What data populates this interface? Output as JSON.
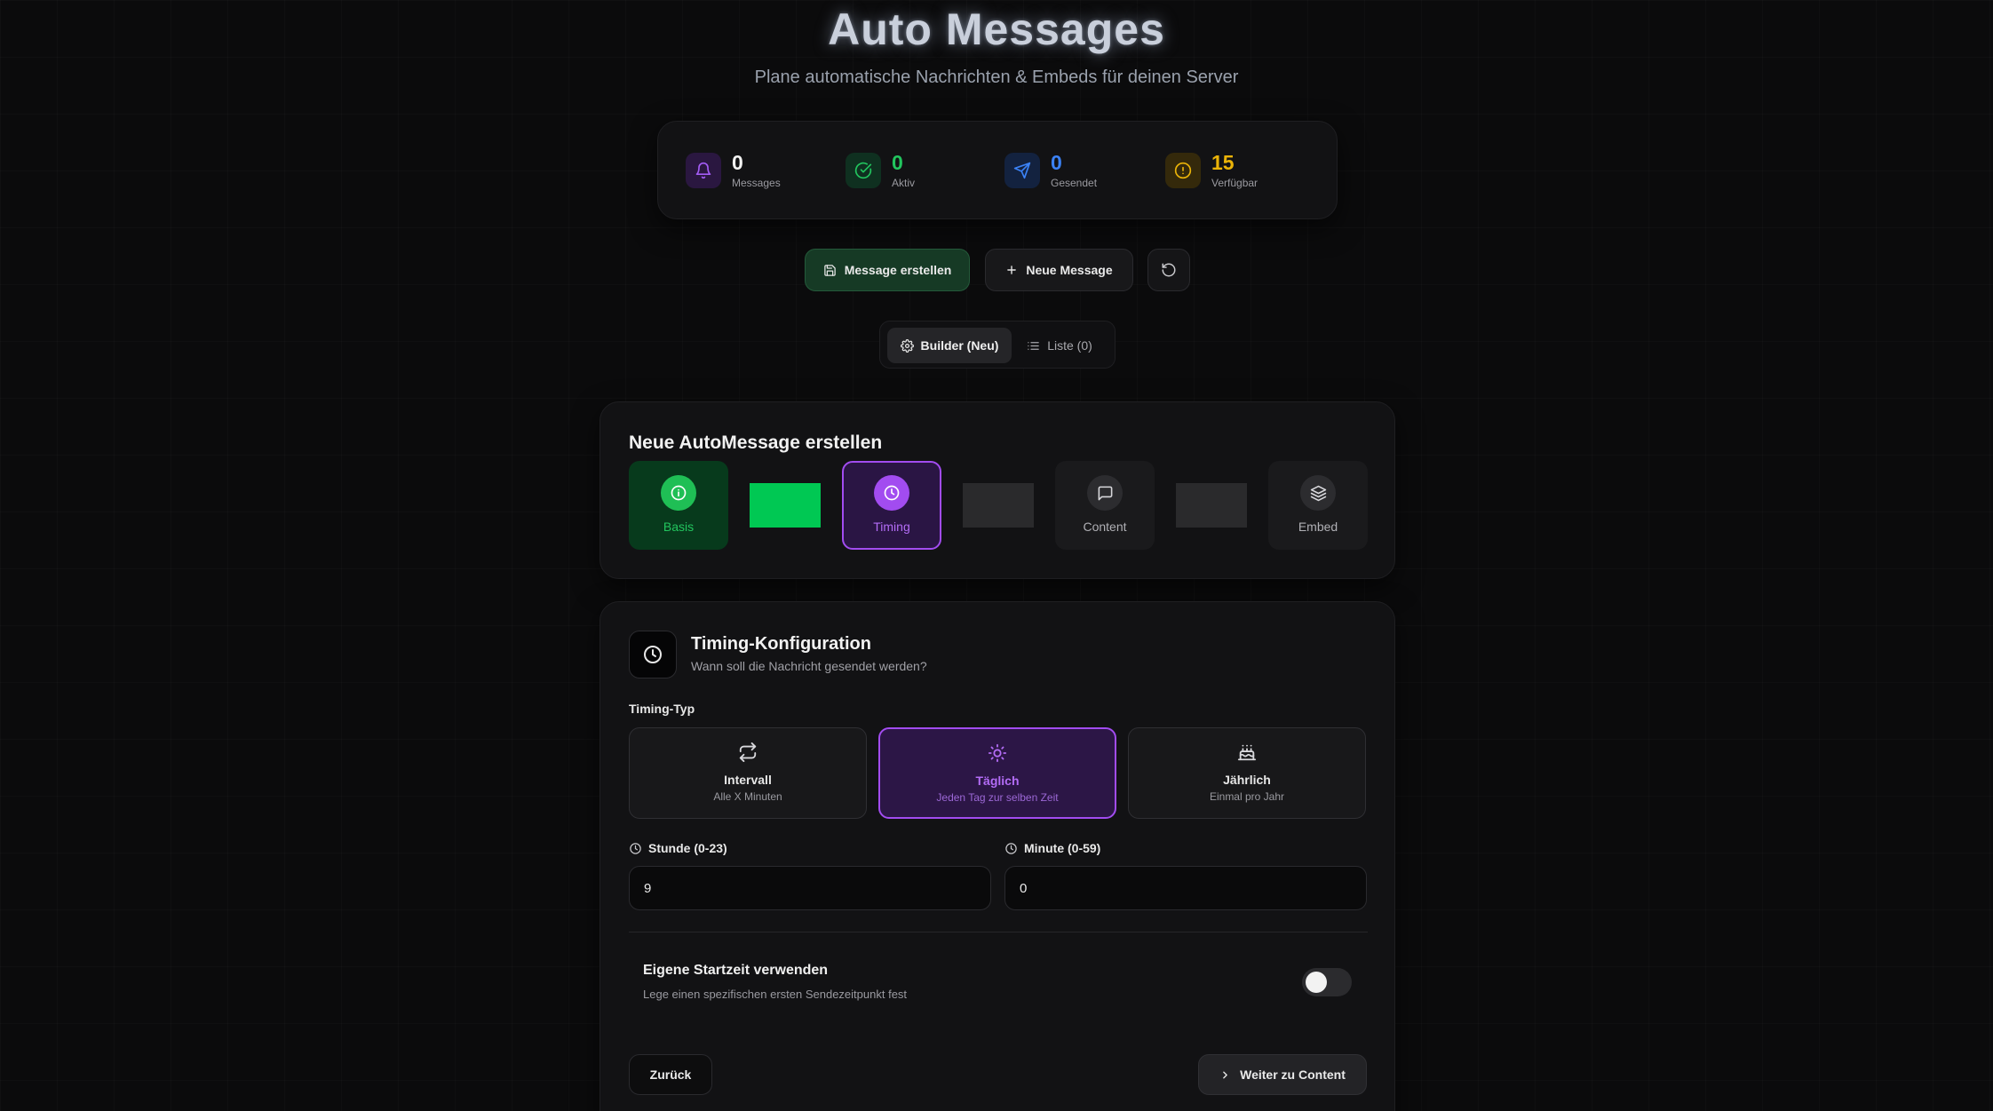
{
  "header": {
    "title": "Auto Messages",
    "subtitle": "Plane automatische Nachrichten & Embeds für deinen Server"
  },
  "stats": [
    {
      "value": "0",
      "label": "Messages",
      "color": "#a35cf5",
      "icon": "bell-icon"
    },
    {
      "value": "0",
      "label": "Aktiv",
      "color": "#22c55e",
      "icon": "check-circle-icon"
    },
    {
      "value": "0",
      "label": "Gesendet",
      "color": "#3b82f6",
      "icon": "send-icon"
    },
    {
      "value": "15",
      "label": "Verfügbar",
      "color": "#eab308",
      "icon": "alert-circle-icon"
    }
  ],
  "actions": {
    "create_label": "Message erstellen",
    "new_label": "Neue Message",
    "refresh_icon": "refresh-icon"
  },
  "view_toggle": {
    "builder_label": "Builder (Neu)",
    "list_label": "Liste (0)"
  },
  "builder": {
    "heading": "Neue AutoMessage erstellen",
    "steps": [
      {
        "label": "Basis",
        "state": "completed",
        "icon": "info-icon"
      },
      {
        "label": "Timing",
        "state": "active",
        "icon": "clock-icon"
      },
      {
        "label": "Content",
        "state": "pending",
        "icon": "message-square-icon"
      },
      {
        "label": "Embed",
        "state": "pending",
        "icon": "layers-icon"
      }
    ]
  },
  "timing": {
    "title": "Timing-Konfiguration",
    "subtitle": "Wann soll die Nachricht gesendet werden?",
    "type_label": "Timing-Typ",
    "types": [
      {
        "name": "Intervall",
        "desc": "Alle X Minuten",
        "icon": "repeat-icon",
        "selected": false
      },
      {
        "name": "Täglich",
        "desc": "Jeden Tag zur selben Zeit",
        "icon": "sun-icon",
        "selected": true
      },
      {
        "name": "Jährlich",
        "desc": "Einmal pro Jahr",
        "icon": "cake-icon",
        "selected": false
      }
    ],
    "hour_label": "Stunde (0-23)",
    "hour_value": "9",
    "minute_label": "Minute (0-59)",
    "minute_value": "0",
    "start_title": "Eigene Startzeit verwenden",
    "start_sub": "Lege einen spezifischen ersten Sendezeitpunkt fest",
    "start_enabled": false,
    "back_label": "Zurück",
    "next_label": "Weiter zu Content"
  },
  "colors": {
    "accent_purple": "#a24cf0",
    "accent_green": "#22c55e",
    "step_connector_done": "#00c853",
    "step_connector_pending": "#2a2a2c"
  }
}
